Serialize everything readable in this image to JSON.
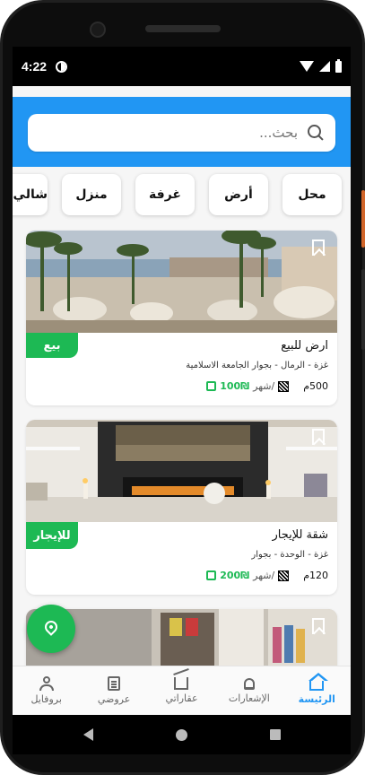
{
  "status_bar": {
    "time": "4:22"
  },
  "search": {
    "placeholder": "بحث..."
  },
  "categories": [
    "محل",
    "أرض",
    "غرفة",
    "منزل",
    "شالي"
  ],
  "listings": [
    {
      "badge": "بيع",
      "title": "ارض للبيع",
      "address": "غزة - الرمال - بجوار الجامعة الاسلامية",
      "price": "100₪",
      "price_period": "/شهر",
      "area": "500م"
    },
    {
      "badge": "للإيجار",
      "title": "شقة للإيجار",
      "address": "غزة - الوحدة - بجوار",
      "price": "200₪",
      "price_period": "/شهر",
      "area": "120م"
    }
  ],
  "bottom_nav": [
    {
      "label": "الرئيسة",
      "icon": "home-icon",
      "active": true
    },
    {
      "label": "الإشعارات",
      "icon": "bell-icon",
      "active": false
    },
    {
      "label": "عقاراتي",
      "icon": "building-icon",
      "active": false
    },
    {
      "label": "عروضي",
      "icon": "document-icon",
      "active": false
    },
    {
      "label": "بروفايل",
      "icon": "user-icon",
      "active": false
    }
  ],
  "colors": {
    "primary": "#2196f3",
    "accent_green": "#1db954"
  }
}
